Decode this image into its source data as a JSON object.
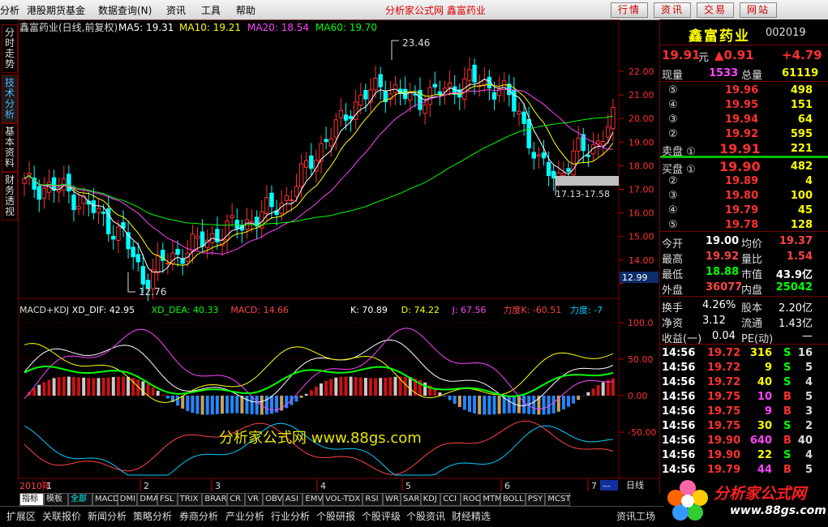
{
  "menu": {
    "items": [
      "分析",
      "港股期货基金",
      "数据查询(N)",
      "资讯",
      "工具",
      "帮助"
    ],
    "center_title": "分析家公式网 鑫富药业",
    "buttons": [
      "行情",
      "资讯",
      "交易",
      "网站"
    ]
  },
  "left_tabs": [
    "分时走势",
    "技术分析",
    "基本资料",
    "财务透视"
  ],
  "header": {
    "title": "鑫富药业(日线,前复权)",
    "ma": [
      {
        "label": "MA5: 19.31",
        "color": "#ffffff"
      },
      {
        "label": "MA10: 19.21",
        "color": "#ffff00"
      },
      {
        "label": "MA20: 18.54",
        "color": "#ff44ff"
      },
      {
        "label": "MA60: 19.70",
        "color": "#00ff00"
      }
    ]
  },
  "annotations": {
    "high": "23.46",
    "low": "12.76",
    "range": "17.13-17.58",
    "price_tag": "12.99"
  },
  "price_axis": [
    "22.00",
    "21.00",
    "20.00",
    "19.00",
    "18.00",
    "17.00",
    "16.00",
    "15.00",
    "14.00",
    "13.00"
  ],
  "indicator_header": {
    "left": [
      {
        "text": "MACD+KDJ",
        "color": "#dddddd"
      },
      {
        "text": "XD_DIF: 42.95",
        "color": "#ffffff"
      },
      {
        "text": "XD_DEA: 40.33",
        "color": "#00ff00"
      },
      {
        "text": "MACD: 14.66",
        "color": "#ff4444"
      }
    ],
    "right": [
      {
        "text": "K: 70.89",
        "color": "#ffffff"
      },
      {
        "text": "D: 74.22",
        "color": "#ffff00"
      },
      {
        "text": "J: 67.56",
        "color": "#ff44ff"
      },
      {
        "text": "力度K: -60.51",
        "color": "#ff4444"
      },
      {
        "text": "力度: -7",
        "color": "#00d0ff"
      }
    ]
  },
  "indicator_axis": [
    "100.0",
    "50.00",
    "0.00",
    "-50.00"
  ],
  "watermark": "分析家公式网 www.88gs.com",
  "date_axis": {
    "year": "2010年",
    "months": [
      "1",
      "2",
      "3",
      "4",
      "5",
      "6",
      "7"
    ],
    "period": "日线"
  },
  "bottom_tabs": [
    "指标",
    "模板",
    "全部",
    "MACD",
    "DMI",
    "DMA",
    "FSL",
    "TRIX",
    "BRAR",
    "CR",
    "VR",
    "OBV",
    "ASI",
    "EMV",
    "VOL-TDX",
    "RSI",
    "WR",
    "SAR",
    "KDJ",
    "CCI",
    "ROC",
    "MTM",
    "BOLL",
    "PSY",
    "MCST"
  ],
  "bottom_bar": [
    "扩展区",
    "关联报价",
    "新闻分析",
    "策略分析",
    "券商分析",
    "产业分析",
    "行业分析",
    "个股研报",
    "个股评级",
    "个股资讯",
    "财经精选",
    "资讯工场"
  ],
  "quote": {
    "name": "鑫富药业",
    "code": "002019",
    "price": "19.91",
    "unit": "元",
    "change": "▲0.91",
    "pct": "+4.79",
    "xianliang_label": "现量",
    "xianliang": "1533",
    "zongliang_label": "总量",
    "zongliang": "61119",
    "sell": [
      {
        "label": "⑤",
        "price": "19.96",
        "vol": "498"
      },
      {
        "label": "④",
        "price": "19.95",
        "vol": "151"
      },
      {
        "label": "③",
        "price": "19.94",
        "vol": "64"
      },
      {
        "label": "②",
        "price": "19.92",
        "vol": "595"
      },
      {
        "label": "卖盘 ①",
        "price": "19.91",
        "vol": "221"
      }
    ],
    "buy": [
      {
        "label": "买盘 ①",
        "price": "19.90",
        "vol": "482"
      },
      {
        "label": "②",
        "price": "19.89",
        "vol": "4"
      },
      {
        "label": "③",
        "price": "19.80",
        "vol": "100"
      },
      {
        "label": "④",
        "price": "19.79",
        "vol": "45"
      },
      {
        "label": "⑤",
        "price": "19.78",
        "vol": "128"
      }
    ],
    "stats": [
      {
        "l1": "今开",
        "v1": "19.00",
        "c1": "#ffffff",
        "l2": "均价",
        "v2": "19.37",
        "c2": "#ff4444"
      },
      {
        "l1": "最高",
        "v1": "19.92",
        "c1": "#ff4444",
        "l2": "量比",
        "v2": "1.54",
        "c2": "#ff4444"
      },
      {
        "l1": "最低",
        "v1": "18.88",
        "c1": "#00ff00",
        "l2": "市值",
        "v2": "43.9亿",
        "c2": "#ffffff"
      },
      {
        "l1": "外盘",
        "v1": "36077",
        "c1": "#ff4444",
        "l2": "内盘",
        "v2": "25042",
        "c2": "#00ff00"
      }
    ],
    "stats2": [
      {
        "l1": "换手",
        "v1": "4.26%",
        "l2": "股本",
        "v2": "2.20亿"
      },
      {
        "l1": "净资",
        "v1": "3.12",
        "l2": "流通",
        "v2": "1.43亿"
      },
      {
        "l1": "收益(一)",
        "v1": "0.04",
        "l2": "PE(动)",
        "v2": "—"
      }
    ],
    "ticks": [
      {
        "t": "14:56",
        "p": "19.72",
        "v": "316",
        "s": "S",
        "n": "16"
      },
      {
        "t": "14:56",
        "p": "19.72",
        "v": "9",
        "s": "S",
        "n": "5"
      },
      {
        "t": "14:56",
        "p": "19.72",
        "v": "40",
        "s": "S",
        "n": "4"
      },
      {
        "t": "14:56",
        "p": "19.75",
        "v": "10",
        "s": "B",
        "n": "5"
      },
      {
        "t": "14:56",
        "p": "19.75",
        "v": "9",
        "s": "B",
        "n": "3"
      },
      {
        "t": "14:56",
        "p": "19.75",
        "v": "30",
        "s": "S",
        "n": "2"
      },
      {
        "t": "14:56",
        "p": "19.90",
        "v": "640",
        "s": "B",
        "n": "40"
      },
      {
        "t": "14:56",
        "p": "19.90",
        "v": "22",
        "s": "S",
        "n": "4"
      },
      {
        "t": "14:56",
        "p": "19.79",
        "v": "44",
        "s": "B",
        "n": "5"
      }
    ]
  },
  "logo": {
    "text": "分析家公式网",
    "url": "www.88gs.com"
  },
  "colors": {
    "up": "#ff3030",
    "down": "#00ffff",
    "bg": "#000000",
    "frame": "#7a0000"
  }
}
